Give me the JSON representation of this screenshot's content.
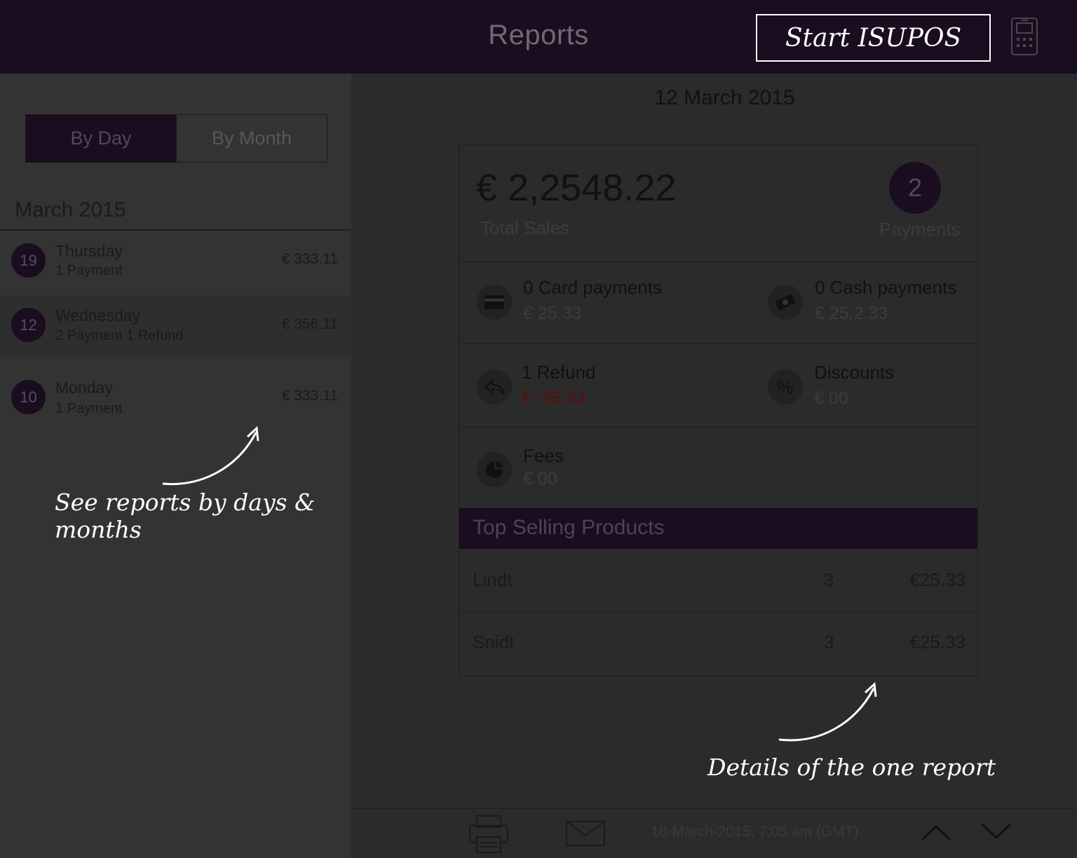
{
  "header": {
    "title": "Reports",
    "start_button": "Start ISUPOS",
    "terminal_icon": "card-terminal-icon"
  },
  "sidebar": {
    "tabs": [
      {
        "label": "By Day",
        "active": true
      },
      {
        "label": "By Month",
        "active": false
      }
    ],
    "month": "March 2015",
    "days": [
      {
        "day": "19",
        "name": "Thursday",
        "sub": "1 Payment",
        "amount": "€ 333.11",
        "selected": false
      },
      {
        "day": "12",
        "name": "Wednesday",
        "sub": "2 Payment 1 Refund",
        "amount": "€ 356.11",
        "selected": true
      },
      {
        "day": "10",
        "name": "Monday",
        "sub": "1 Payment",
        "amount": "€ 333.11",
        "selected": false
      }
    ],
    "annotation": "See reports by days & months"
  },
  "report": {
    "date": "12 March 2015",
    "total": "€ 2,2548.22",
    "total_label": "Total Sales",
    "payments_count": "2",
    "payments_label": "Payments",
    "card": {
      "title": "0 Card payments",
      "value": "€ 25.33",
      "icon": "credit-card-icon"
    },
    "cash": {
      "title": "0 Cash payments",
      "value": "€ 25,2.33",
      "icon": "cash-icon"
    },
    "refund": {
      "title": "1 Refund",
      "value": "€ -25.33",
      "icon": "refund-icon"
    },
    "discounts": {
      "title": "Discounts",
      "value": "€ 00",
      "icon": "percent-icon"
    },
    "fees": {
      "title": "Fees",
      "value": "€ 00",
      "icon": "fees-icon"
    },
    "top_selling_title": "Top Selling Products",
    "products": [
      {
        "name": "Lindt",
        "qty": "3",
        "price": "€25.33"
      },
      {
        "name": "Snidt",
        "qty": "3",
        "price": "€25.33"
      }
    ],
    "annotation": "Details of the one report"
  },
  "footer": {
    "timestamp": "18-March-2015, 7:05 am (GMT)",
    "print_icon": "printer-icon",
    "email_icon": "envelope-icon",
    "up_icon": "chevron-up-icon",
    "down_icon": "chevron-down-icon"
  },
  "colors": {
    "header_bg": "#1a0d1f",
    "accent": "#1a0d1f",
    "panel_bg": "#333333",
    "refund_red": "#5a0f0f"
  }
}
